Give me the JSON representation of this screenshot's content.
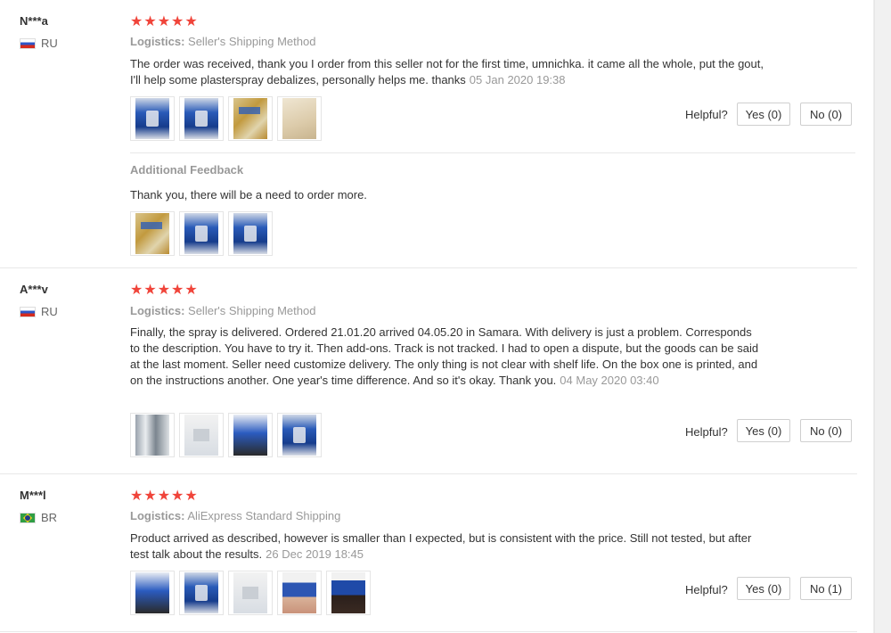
{
  "reviews": [
    {
      "user": "N***a",
      "country_code": "RU",
      "flag": "ru-flag",
      "stars": "★★★★★",
      "rating": 5,
      "logistics_label": "Logistics:",
      "logistics_value": "Seller's Shipping Method",
      "text": "The order was received, thank you I order from this seller not for the first time, umnichka. it came all the whole, put the gout, I'll help some plasterspray debalizes, personally helps me. thanks",
      "date": "05 Jan 2020 19:38",
      "photos": [
        "photo-blue",
        "photo-blue",
        "photo-gold",
        "photo-beige"
      ],
      "helpful_label": "Helpful?",
      "yes_label": "Yes (0)",
      "no_label": "No (0)",
      "additional": {
        "title": "Additional Feedback",
        "text": "Thank you, there will be a need to order more.",
        "photos": [
          "photo-gold",
          "photo-blue",
          "photo-blue"
        ]
      }
    },
    {
      "user": "A***v",
      "country_code": "RU",
      "flag": "ru-flag",
      "stars": "★★★★★",
      "rating": 5,
      "logistics_label": "Logistics:",
      "logistics_value": "Seller's Shipping Method",
      "text": "Finally, the spray is delivered. Ordered 21.01.20 arrived 04.05.20 in Samara. With delivery is just a problem. Corresponds to the description. You have to try it. Then add-ons. Track is not tracked. I had to open a dispute, but the goods can be said at the last moment. Seller need customize delivery. The only thing is not clear with shelf life. On the box one is printed, and on the instructions another. One year's time difference. And so it's okay. Thank you.",
      "date": "04 May 2020 03:40",
      "photos": [
        "photo-grey",
        "photo-light",
        "photo-mixed",
        "photo-blue"
      ],
      "helpful_label": "Helpful?",
      "yes_label": "Yes (0)",
      "no_label": "No (0)"
    },
    {
      "user": "M***l",
      "country_code": "BR",
      "flag": "br-flag",
      "stars": "★★★★★",
      "rating": 5,
      "logistics_label": "Logistics:",
      "logistics_value": "AliExpress Standard Shipping",
      "text": "Product arrived as described, however is smaller than I expected, but is consistent with the price. Still not tested, but after test talk about the results.",
      "date": "26 Dec 2019 18:45",
      "photos": [
        "photo-mixed",
        "photo-blue",
        "photo-light",
        "photo-hand",
        "photo-dark"
      ],
      "helpful_label": "Helpful?",
      "yes_label": "Yes (0)",
      "no_label": "No (1)"
    }
  ]
}
